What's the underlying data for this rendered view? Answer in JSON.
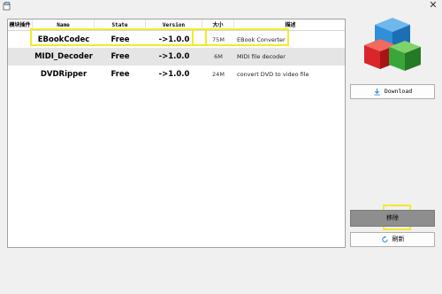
{
  "window": {
    "app_icon": "app-icon",
    "close_glyph": "✕"
  },
  "table": {
    "headers": [
      "模块插件",
      "Name",
      "State",
      "Version",
      "大小",
      "描述"
    ],
    "rows": [
      {
        "name": "EBookCodec",
        "state": "Free",
        "version": "->1.0.0",
        "size": "75M",
        "description": "EBook Converter"
      },
      {
        "name": "MIDI_Decoder",
        "state": "Free",
        "version": "->1.0.0",
        "size": "6M",
        "description": "MIDI file decoder"
      },
      {
        "name": "DVDRipper",
        "state": "Free",
        "version": "->1.0.0",
        "size": "24M",
        "description": "convert DVD to video file"
      }
    ],
    "selected_row": 1
  },
  "buttons": {
    "download_label": "Download",
    "download_icon": "download-icon",
    "remove_label": "移除",
    "refresh_label": "刷新",
    "refresh_icon": "refresh-icon"
  },
  "colors": {
    "highlight": "#f3ea2a",
    "selected_row": "#e5e5e5",
    "remove_button": "#8e8e8e",
    "cube_red": "#d8262a",
    "cube_green": "#3aa63a",
    "cube_blue": "#2f8fd8"
  }
}
